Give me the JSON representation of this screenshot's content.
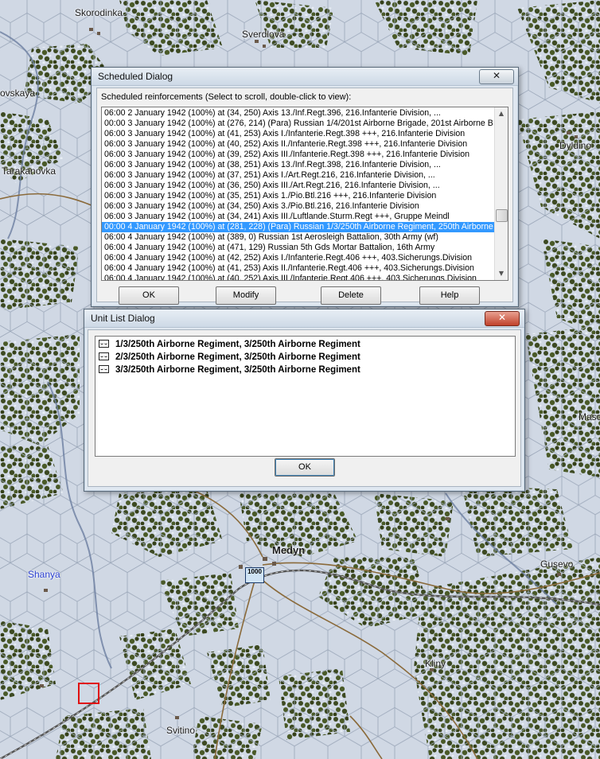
{
  "map": {
    "towns": [
      "Skorodinka",
      "Sverdlova",
      "ovskaya",
      "Tarakanovka",
      "Dyldino",
      "Masc",
      "Medyn",
      "Shanya",
      "Gusevo",
      "Kliny",
      "Svitino"
    ],
    "unit_counter": "1000"
  },
  "scheduled_dialog": {
    "title": "Scheduled Dialog",
    "close": "✕",
    "caption": "Scheduled reinforcements (Select to scroll, double-click to view):",
    "rows": [
      "06:00 2 January 1942 (100%) at (34, 250) Axis 13./Inf.Regt.396, 216.Infanterie Division, ...",
      "00:00 3 January 1942 (100%) at (276, 214) (Para) Russian 1/4/201st Airborne Brigade, 201st Airborne B",
      "06:00 3 January 1942 (100%) at (41, 253) Axis I./Infanterie.Regt.398 +++, 216.Infanterie Division",
      "06:00 3 January 1942 (100%) at (40, 252) Axis II./Infanterie.Regt.398 +++, 216.Infanterie Division",
      "06:00 3 January 1942 (100%) at (39, 252) Axis III./Infanterie.Regt.398 +++, 216.Infanterie Division",
      "06:00 3 January 1942 (100%) at (38, 251) Axis 13./Inf.Regt.398, 216.Infanterie Division, ...",
      "06:00 3 January 1942 (100%) at (37, 251) Axis I./Art.Regt.216, 216.Infanterie Division, ...",
      "06:00 3 January 1942 (100%) at (36, 250) Axis III./Art.Regt.216, 216.Infanterie Division, ...",
      "06:00 3 January 1942 (100%) at (35, 251) Axis 1./Pio.Btl.216 +++, 216.Infanterie Division",
      "06:00 3 January 1942 (100%) at (34, 250) Axis 3./Pio.Btl.216, 216.Infanterie Division",
      "06:00 3 January 1942 (100%) at (34, 241) Axis III./Luftlande.Sturm.Regt +++, Gruppe Meindl",
      "00:00 4 January 1942 (100%) at (281, 228) (Para) Russian 1/3/250th Airborne Regiment, 250th Airborne",
      "06:00 4 January 1942 (100%) at (389, 0) Russian 1st Aerosleigh Battalion, 30th Army (wf)",
      "06:00 4 January 1942 (100%) at (471, 129) Russian 5th Gds Mortar Battalion, 16th Army",
      "06:00 4 January 1942 (100%) at (42, 252) Axis I./Infanterie.Regt.406 +++, 403.Sicherungs.Division",
      "06:00 4 January 1942 (100%) at (41, 253) Axis II./Infanterie.Regt.406 +++, 403.Sicherungs.Division",
      "06:00 4 January 1942 (100%) at (40, 252) Axis III./Infanterie.Regt.406 +++, 403.Sicherungs.Division"
    ],
    "selected_index": 11,
    "buttons": {
      "ok": "OK",
      "modify": "Modify",
      "delete": "Delete",
      "help": "Help"
    }
  },
  "unit_list_dialog": {
    "title": "Unit List Dialog",
    "close": "✕",
    "units": [
      "1/3/250th Airborne Regiment, 3/250th Airborne Regiment",
      "2/3/250th Airborne Regiment, 3/250th Airborne Regiment",
      "3/3/250th Airborne Regiment, 3/250th Airborne Regiment"
    ],
    "ok": "OK"
  }
}
